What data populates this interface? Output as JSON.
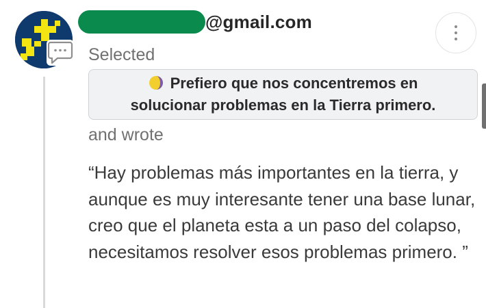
{
  "author": {
    "email_domain": "@gmail.com",
    "redaction_color": "#0a8a4c",
    "avatar_colors": {
      "background": "#0f3a6e",
      "pattern": "#f2e512"
    }
  },
  "icons": {
    "comment": "comment-icon",
    "more": "more-vertical-icon",
    "moon": "moon-phase-icon"
  },
  "labels": {
    "selected": "Selected",
    "wrote": "and wrote"
  },
  "selected_option": {
    "text": "Prefiero que nos concentremos en solucionar problemas en la Tierra primero."
  },
  "response": {
    "text": "“Hay problemas más importantes en la tierra, y aunque es muy interesante tener una base lunar, creo que el planeta esta a un paso del colapso, necesitamos resolver esos problemas primero. ”"
  }
}
